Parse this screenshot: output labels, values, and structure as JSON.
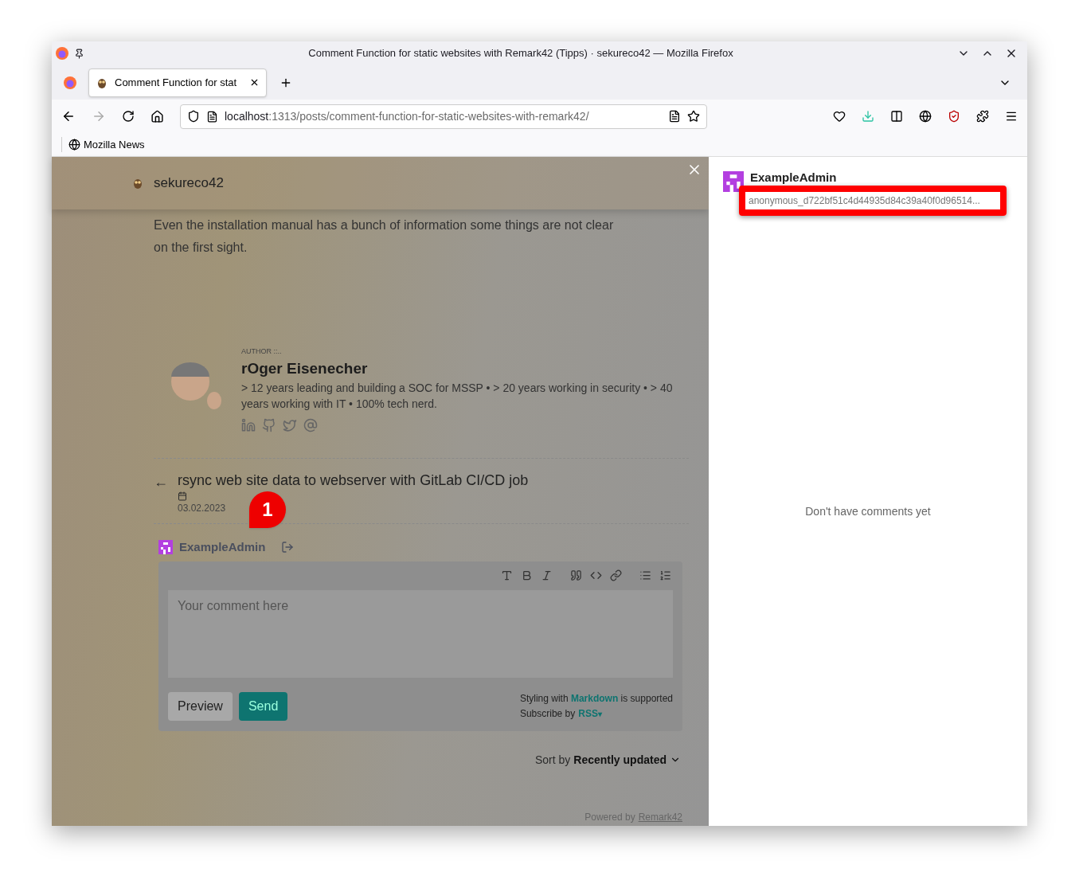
{
  "window": {
    "title": "Comment Function for static websites with Remark42 (Tipps) · sekureco42 — Mozilla Firefox"
  },
  "tabs": [
    {
      "label": "Comment Function for stat",
      "selected": true
    }
  ],
  "address_bar": {
    "host": "localhost",
    "path": ":1313/posts/comment-function-for-static-websites-with-remark42/"
  },
  "bookmarks": [
    {
      "label": "Mozilla News"
    }
  ],
  "site": {
    "name": "sekureco42",
    "intro": "Even the installation manual has a bunch of information some things are not clear on the first sight.",
    "author": {
      "label": "AUTHOR ::..",
      "name": "rOger Eisenecher",
      "bio": "> 12 years leading and building a SOC for MSSP • > 20 years working in security • > 40 years working with IT • 100% tech nerd."
    },
    "prev_post": {
      "arrow": "←",
      "title": "rsync web site data to webserver with GitLab CI/CD job",
      "date": "03.02.2023"
    }
  },
  "comments": {
    "user": "ExampleAdmin",
    "placeholder": "Your comment here",
    "buttons": [
      {
        "label": "Preview",
        "kind": "plain"
      },
      {
        "label": "Send",
        "kind": "primary"
      }
    ],
    "hint": "Styling with **Markdown** is supported",
    "subscribe": "Subscribe by",
    "rss": "RSS",
    "rss_caret": "▾",
    "sort_label": "Sort by",
    "sort_value": "Recently updated",
    "powered_by": "Powered by",
    "powered_link": "Remark42"
  },
  "annotation": {
    "number": "1"
  },
  "user_panel": {
    "name": "ExampleAdmin",
    "id": "anonymous_d722bf51c4d44935d84c39a40f0d96514...",
    "empty": "Don't have comments yet"
  }
}
